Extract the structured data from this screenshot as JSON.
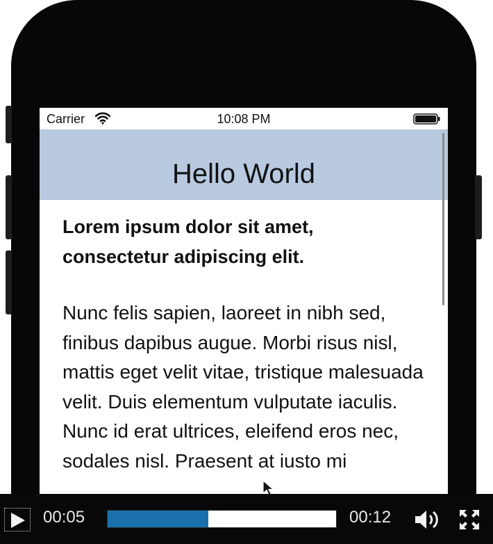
{
  "status_bar": {
    "carrier": "Carrier",
    "time": "10:08 PM",
    "icons": [
      "wifi-icon",
      "battery-icon"
    ]
  },
  "nav_bar": {
    "title": "Hello World",
    "background": "#b8c9e0"
  },
  "content": {
    "lead": "Lorem ipsum dolor sit amet, consectetur adipiscing elit.",
    "body": "Nunc felis sapien, laoreet in nibh sed, finibus dapibus augue. Morbi risus nisl, mattis eget velit vitae, tristique malesuada velit. Duis elementum vulputate iaculis. Nunc id erat ultrices, eleifend eros nec, sodales nisl. Praesent at iusto mi"
  },
  "player": {
    "current_time": "00:05",
    "total_time": "00:12",
    "progress_percent": 44,
    "accent_color": "#1a70ad",
    "icons": [
      "play-icon",
      "volume-icon",
      "fullscreen-icon"
    ]
  }
}
